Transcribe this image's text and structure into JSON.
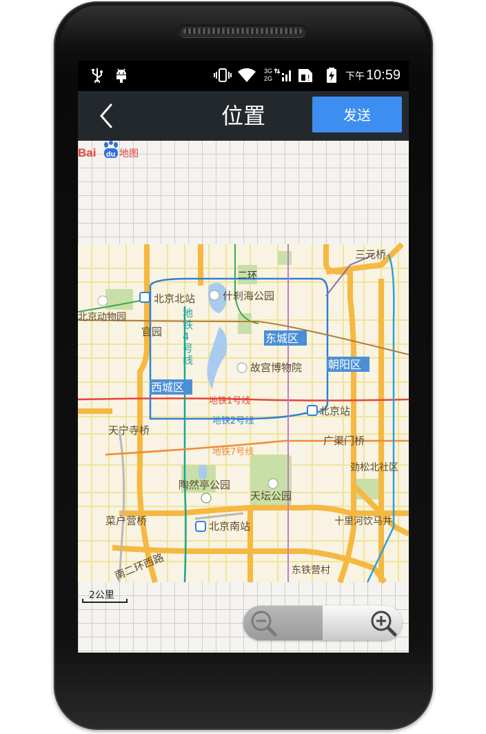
{
  "status_bar": {
    "icons": [
      "usb-icon",
      "android-debug-icon",
      "vibrate-icon",
      "wifi-icon",
      "signal-3g-2g-icon",
      "sim-icon",
      "battery-charging-icon"
    ],
    "network_labels": [
      "3G",
      "2G"
    ],
    "time_prefix": "下午",
    "time": "10:59"
  },
  "header": {
    "back_icon": "chevron-left-icon",
    "title": "位置",
    "send_label": "发送",
    "send_color": "#3d8ef0",
    "bar_color": "#23282d"
  },
  "map": {
    "labels": {
      "sanyuanqiao": "三元桥",
      "erhuan": "二环",
      "beijing_north_station": "北京北站",
      "shichahai_park": "什刹海公园",
      "beijing_zoo": "北京动物园",
      "guanyuan": "官园",
      "subway4": "地铁4号线",
      "dongcheng": "东城区",
      "palace_museum": "故宫博物院",
      "chaoyang": "朝阳区",
      "xicheng": "西城区",
      "subway1": "地铁1号线",
      "beijing_station": "北京站",
      "tianningsi_bridge": "天宁寺桥",
      "subway2": "地铁2号线",
      "guangqumen_bridge": "广渠门桥",
      "subway7": "地铁7号线",
      "jinsong_north": "劲松北社区",
      "taoranting_park": "陶然亭公园",
      "temple_of_heaven": "天坛公园",
      "caihuying_bridge": "菜户营桥",
      "beijing_south_station": "北京南站",
      "shilihe": "十里河饮马井",
      "south_2nd_ring_west": "南二环西路",
      "dongtieyingcun": "东铁营村"
    },
    "scale_label": "2公里",
    "zoom_out_icon": "zoom-out-icon",
    "zoom_in_icon": "zoom-in-icon",
    "logo_text": "Bai地图",
    "logo_sub": "du",
    "colors": {
      "road_major": "#f5b841",
      "road_minor": "#f3e7a7",
      "district_label_bg": "#4a8fd6",
      "subway1": "#e2453a",
      "subway2": "#2f7fd3",
      "subway4": "#1aa39a",
      "subway7": "#f08a35",
      "water": "#a9cbee",
      "park": "#c9dfa8"
    }
  }
}
